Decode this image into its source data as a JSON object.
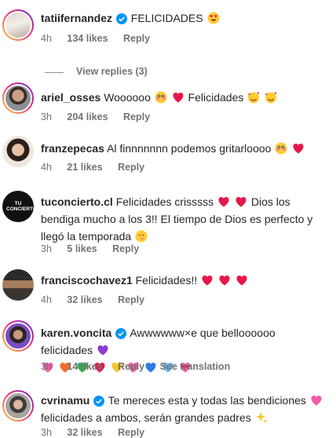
{
  "comments": [
    {
      "username": "tatiifernandez",
      "verified": true,
      "text": "FELICIDADES",
      "time": "4h",
      "likes": "134 likes",
      "reply": "Reply"
    },
    {
      "username": "ariel_osses",
      "verified": false,
      "text": "Woooooo",
      "text2": "Felicidades",
      "time": "3h",
      "likes": "204 likes",
      "reply": "Reply"
    },
    {
      "username": "franzepecas",
      "verified": false,
      "text": "Al finnnnnnn podemos gritarloooo",
      "time": "4h",
      "likes": "21 likes",
      "reply": "Reply"
    },
    {
      "username": "tuconcierto.cl",
      "verified": false,
      "text": "Felicidades crisssss",
      "text2": "Dios los bendiga mucho a los 3!! El tiempo de Dios es perfecto y llegó la temporada",
      "time": "3h",
      "likes": "5 likes",
      "reply": "Reply"
    },
    {
      "username": "franciscochavez1",
      "verified": false,
      "text": "Felicidades!!",
      "time": "4h",
      "likes": "32 likes",
      "reply": "Reply"
    },
    {
      "username": "karen.voncita",
      "verified": true,
      "text": "Awwwwww×e que belloooooo felicidades",
      "time": "3h",
      "likes": "14 likes",
      "reply": "Reply",
      "translate": "See translation"
    },
    {
      "username": "cvrinamu",
      "verified": true,
      "text": "Te mereces esta y todas las bendiciones",
      "text2": "felicidades a ambos, serán grandes padres",
      "time": "3h",
      "likes": "32 likes",
      "reply": "Reply"
    }
  ],
  "view_replies": "View replies (3)",
  "avatar_tuconcierto_text": "TU CONCIERTO",
  "colors": {
    "red_heart": "#e8174b",
    "muted": "#737373",
    "verified": "#0095f6"
  }
}
